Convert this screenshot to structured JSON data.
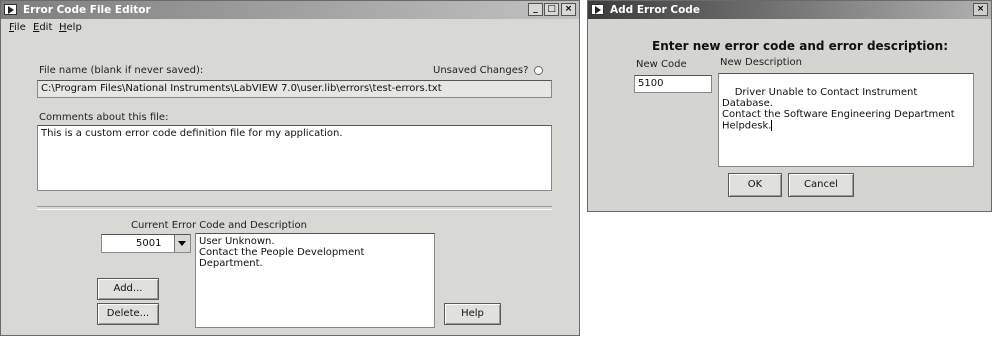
{
  "editor": {
    "title": "Error Code File Editor",
    "window_controls": [
      "_",
      "□",
      "×"
    ],
    "menu": [
      {
        "label": "File",
        "underline": "F",
        "rest": "ile"
      },
      {
        "label": "Edit",
        "underline": "E",
        "rest": "dit"
      },
      {
        "label": "Help",
        "underline": "H",
        "rest": "elp"
      }
    ],
    "file_name_label": "File name (blank if never saved):",
    "unsaved_label": "Unsaved Changes?",
    "file_path": "C:\\Program Files\\National Instruments\\LabVIEW 7.0\\user.lib\\errors\\test-errors.txt",
    "comments_label": "Comments about this file:",
    "comments_value": "This is a custom error code definition file for my application.",
    "current_label": "Current Error Code and Description",
    "current_code": "5001",
    "current_description": "User Unknown.\nContact the People Development Department.",
    "add_button": "Add...",
    "delete_button": "Delete...",
    "help_button": "Help"
  },
  "dialog": {
    "title": "Add Error Code",
    "close": "×",
    "heading": "Enter new error code and error description:",
    "new_code_label": "New Code",
    "new_description_label": "New Description",
    "new_code_value": "5100",
    "new_description_value": "Driver Unable to Contact Instrument Database.\nContact the Software Engineering Department\nHelpdesk.",
    "ok_button": "OK",
    "cancel_button": "Cancel"
  }
}
